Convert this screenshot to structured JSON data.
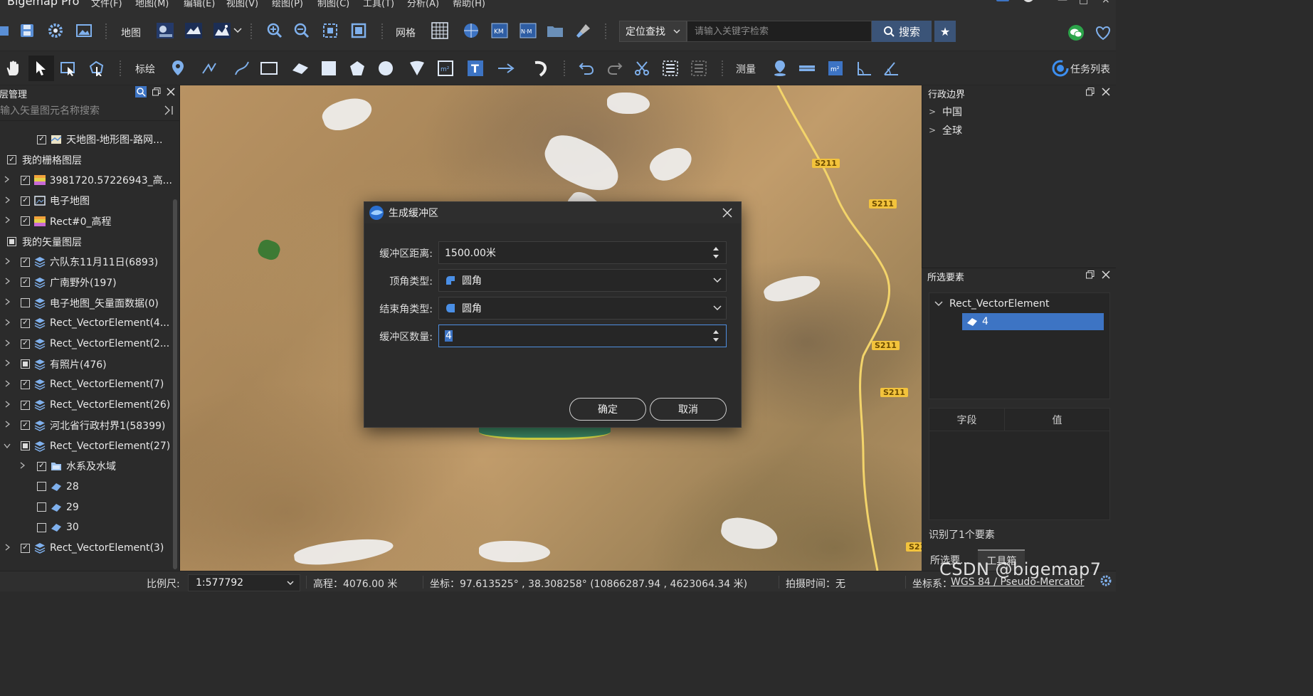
{
  "app": {
    "title": "Bigemap Pro",
    "menus": [
      "文件(F)",
      "地图(M)",
      "编辑(E)",
      "视图(V)",
      "绘图(P)",
      "制图(C)",
      "工具(T)",
      "分析(A)",
      "帮助(H)"
    ]
  },
  "toolbar1": {
    "map_label": "地图",
    "grid_label": "网格",
    "locate_select": "定位查找",
    "search_placeholder": "请输入关键字检索",
    "search_button": "搜索"
  },
  "toolbar2": {
    "draw_label": "标绘",
    "measure_label": "测量",
    "task_list": "任务列表"
  },
  "layer_panel": {
    "title": "图层管理",
    "search_placeholder": "请输入矢量图元名称搜索",
    "rows": [
      {
        "label": "天地图-地形图-路网...",
        "indent": 2,
        "chev": "",
        "check": "checked",
        "icon": "map-icon"
      },
      {
        "label": "我的栅格图层",
        "indent": 0,
        "chev": "",
        "check": "checked",
        "icon": ""
      },
      {
        "label": "3981720.57226943_高...",
        "indent": 1,
        "chev": ">",
        "check": "checked",
        "icon": "raster-icon"
      },
      {
        "label": "电子地图",
        "indent": 1,
        "chev": ">",
        "check": "checked",
        "icon": "image-icon"
      },
      {
        "label": "Rect#0_高程",
        "indent": 1,
        "chev": ">",
        "check": "checked",
        "icon": "raster-icon"
      },
      {
        "label": "我的矢量图层",
        "indent": 0,
        "chev": "",
        "check": "partial",
        "icon": ""
      },
      {
        "label": "六队东11月11日(6893)",
        "indent": 1,
        "chev": ">",
        "check": "checked",
        "icon": "layers-icon"
      },
      {
        "label": "广南野外(197)",
        "indent": 1,
        "chev": ">",
        "check": "checked",
        "icon": "layers-icon"
      },
      {
        "label": "电子地图_矢量面数据(0)",
        "indent": 1,
        "chev": ">",
        "check": "unchecked",
        "icon": "layers-icon"
      },
      {
        "label": "Rect_VectorElement(4...",
        "indent": 1,
        "chev": ">",
        "check": "checked",
        "icon": "layers-icon"
      },
      {
        "label": "Rect_VectorElement(2...",
        "indent": 1,
        "chev": ">",
        "check": "checked",
        "icon": "layers-icon"
      },
      {
        "label": "有照片(476)",
        "indent": 1,
        "chev": ">",
        "check": "partial",
        "icon": "layers-icon"
      },
      {
        "label": "Rect_VectorElement(7)",
        "indent": 1,
        "chev": ">",
        "check": "checked",
        "icon": "layers-icon"
      },
      {
        "label": "Rect_VectorElement(26)",
        "indent": 1,
        "chev": ">",
        "check": "checked",
        "icon": "layers-icon"
      },
      {
        "label": "河北省行政村界1(58399)",
        "indent": 1,
        "chev": ">",
        "check": "checked",
        "icon": "layers-icon"
      },
      {
        "label": "Rect_VectorElement(27)",
        "indent": 1,
        "chev": "v",
        "check": "partial",
        "icon": "layers-icon"
      },
      {
        "label": "水系及水域",
        "indent": 2,
        "chev": ">",
        "check": "checked",
        "icon": "folder-icon"
      },
      {
        "label": "28",
        "indent": 2,
        "chev": "",
        "check": "unchecked",
        "icon": "polygon-icon"
      },
      {
        "label": "29",
        "indent": 2,
        "chev": "",
        "check": "unchecked",
        "icon": "polygon-icon"
      },
      {
        "label": "30",
        "indent": 2,
        "chev": "",
        "check": "unchecked",
        "icon": "polygon-icon"
      },
      {
        "label": "Rect_VectorElement(3)",
        "indent": 1,
        "chev": ">",
        "check": "checked",
        "icon": "layers-icon"
      }
    ]
  },
  "map": {
    "road_badges": [
      "S211",
      "S211",
      "S211",
      "S211",
      "S21"
    ]
  },
  "admin_panel": {
    "title": "行政边界",
    "items": [
      "中国",
      "全球"
    ]
  },
  "selected_panel": {
    "title": "所选要素",
    "parent": "Rect_VectorElement",
    "child": "4",
    "col_field": "字段",
    "col_value": "值",
    "status": "识别了1个要素",
    "tabs": [
      "所选要...",
      "工具箱"
    ]
  },
  "dialog": {
    "title": "生成缓冲区",
    "distance_label": "缓冲区距离:",
    "distance_value": "1500.00米",
    "corner_label": "顶角类型:",
    "corner_value": "圆角",
    "end_label": "结束角类型:",
    "end_value": "圆角",
    "count_label": "缓冲区数量:",
    "count_value": "4",
    "ok": "确定",
    "cancel": "取消"
  },
  "statusbar": {
    "scale_label": "比例尺:",
    "scale_value": "1:577792",
    "elevation": "高程：4076.00 米",
    "coords": "坐标：97.613525° , 38.308258°   (10866287.94 , 4623064.34 米)",
    "capture_time": "拍摄时间：无",
    "crs_label": "坐标系：",
    "crs_value": "WGS 84 / Pseudo-Mercator"
  },
  "watermark": "CSDN @bigemap7",
  "colors": {
    "accent": "#3d74c4",
    "panel": "#2b2b2b",
    "search_button": "#3b5478",
    "road": "#f3c33c"
  }
}
